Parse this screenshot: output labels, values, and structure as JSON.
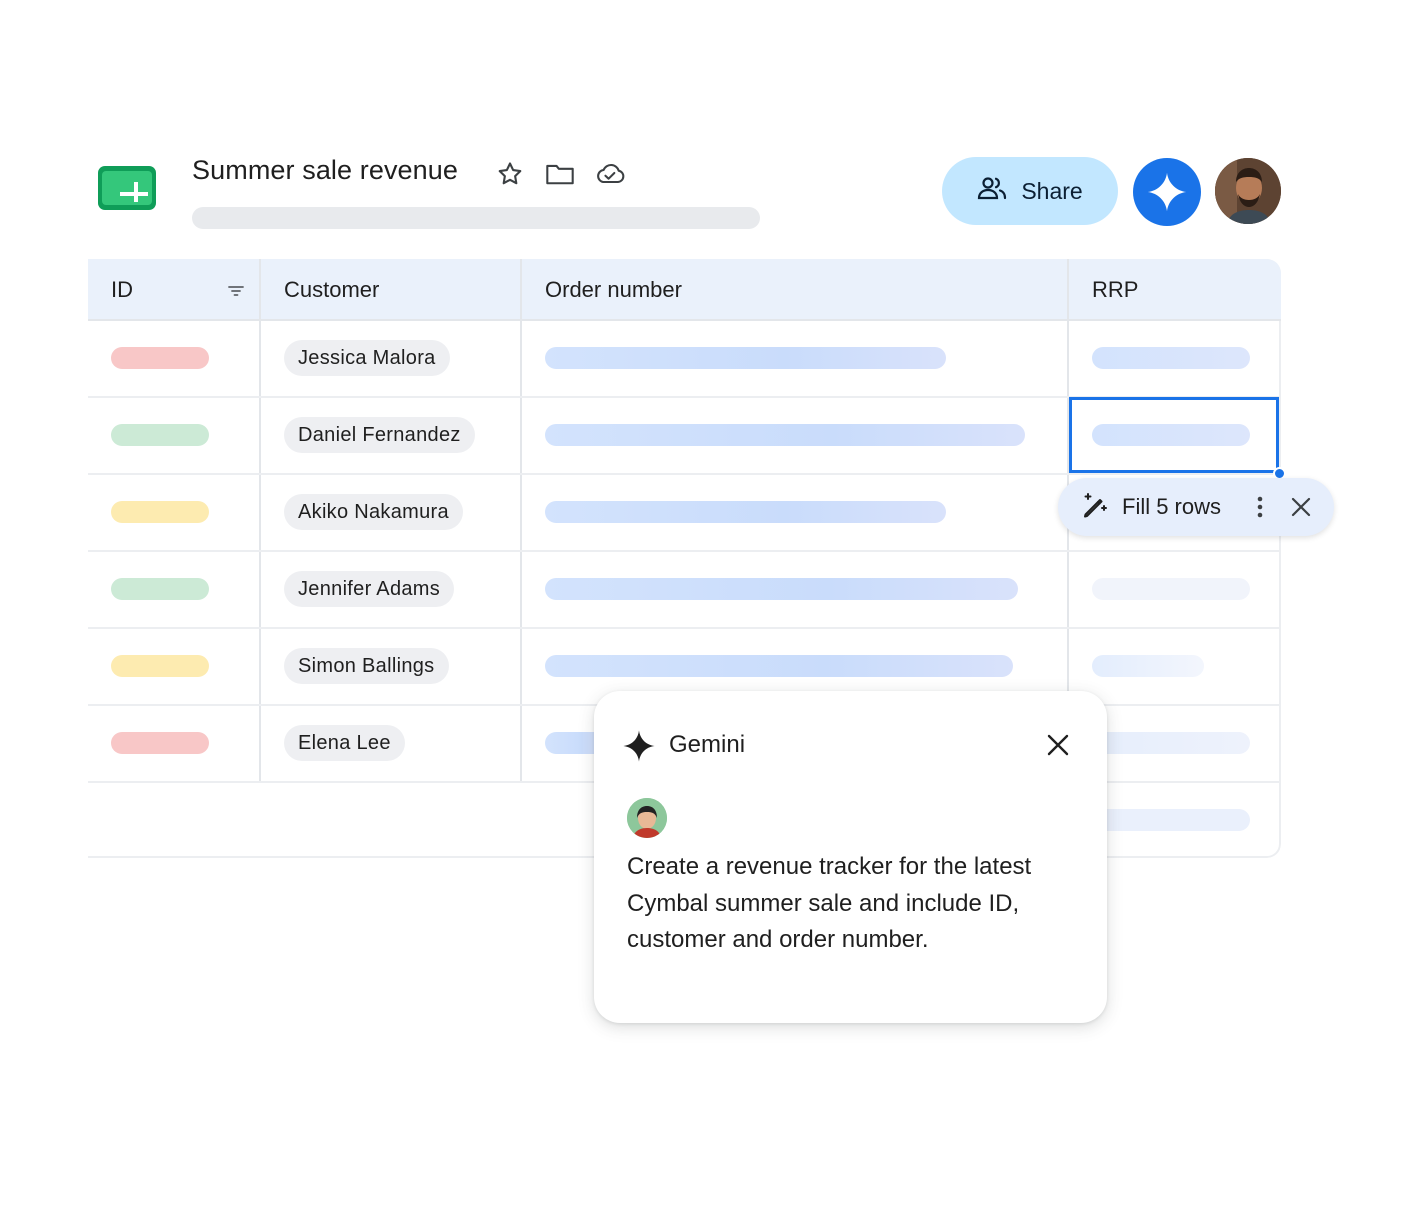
{
  "document": {
    "title": "Summer sale revenue"
  },
  "header": {
    "share_label": "Share",
    "icons": [
      "star-icon",
      "folder-icon",
      "cloud-done-icon",
      "people-icon",
      "gemini-spark-icon"
    ]
  },
  "table": {
    "columns": [
      "ID",
      "Customer",
      "Order number",
      "RRP"
    ],
    "rows": [
      {
        "customer": "Jessica Malora",
        "id_status_color": "#f8c7c7"
      },
      {
        "customer": "Daniel Fernandez",
        "id_status_color": "#ccead6"
      },
      {
        "customer": "Akiko Nakamura",
        "id_status_color": "#fdebb0"
      },
      {
        "customer": "Jennifer Adams",
        "id_status_color": "#ccead6"
      },
      {
        "customer": "Simon Ballings",
        "id_status_color": "#fdebb0"
      },
      {
        "customer": "Elena Lee",
        "id_status_color": "#f8c7c7"
      }
    ]
  },
  "fill_chip": {
    "label": "Fill 5 rows"
  },
  "gemini_panel": {
    "title": "Gemini",
    "prompt": "Create a revenue tracker for the latest Cymbal summer sale and include ID, customer and order number."
  },
  "colors": {
    "accent": "#1a73e8",
    "share_bg": "#c2e7ff",
    "header_bg": "#eaf1fb"
  }
}
